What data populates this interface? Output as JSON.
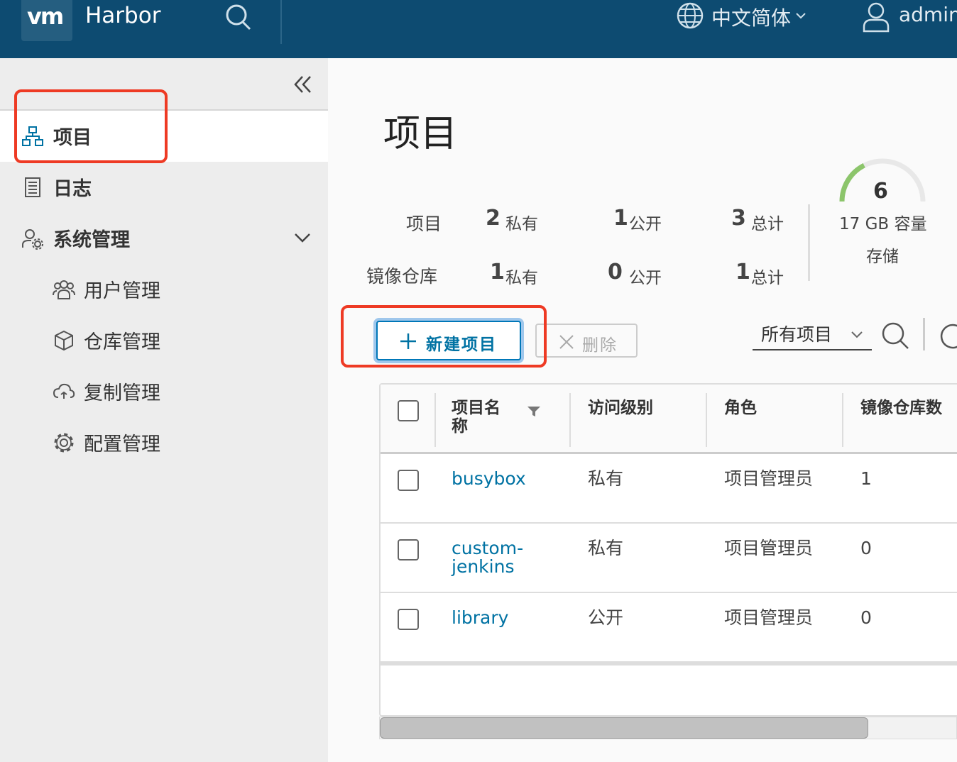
{
  "header": {
    "logo": "vm",
    "app_title": "Harbor",
    "language": "中文简体",
    "user": "admin"
  },
  "sidebar": {
    "items": [
      {
        "label": "项目",
        "icon": "project-icon",
        "active": true
      },
      {
        "label": "日志",
        "icon": "log-icon"
      },
      {
        "label": "系统管理",
        "icon": "admin-icon",
        "expanded": true
      }
    ],
    "sub_items": [
      {
        "label": "用户管理",
        "icon": "users-icon"
      },
      {
        "label": "仓库管理",
        "icon": "box-icon"
      },
      {
        "label": "复制管理",
        "icon": "cloud-sync-icon"
      },
      {
        "label": "配置管理",
        "icon": "gear-icon"
      }
    ]
  },
  "main": {
    "title": "项目",
    "stats": {
      "projects": {
        "label": "项目",
        "private": "2",
        "public": "1",
        "total": "3"
      },
      "repos": {
        "label": "镜像仓库",
        "private": "1",
        "public": "0",
        "total": "1"
      },
      "private_unit": "私有",
      "public_unit": "公开",
      "total_unit": "总计"
    },
    "storage": {
      "value": "6",
      "caption": "17 GB 容量",
      "label": "存储",
      "fill_fraction": 0.35
    },
    "toolbar": {
      "new_label": "新建项目",
      "delete_label": "删除",
      "filter_value": "所有项目"
    },
    "table": {
      "columns": [
        "项目名称",
        "访问级别",
        "角色",
        "镜像仓库数"
      ],
      "rows": [
        {
          "name": "busybox",
          "access": "私有",
          "role": "项目管理员",
          "repos": "1"
        },
        {
          "name": "custom-jenkins",
          "name_l1": "custom-",
          "name_l2": "jenkins",
          "access": "私有",
          "role": "项目管理员",
          "repos": "0"
        },
        {
          "name": "library",
          "access": "公开",
          "role": "项目管理员",
          "repos": "0"
        }
      ]
    }
  },
  "colors": {
    "header_bg": "#0d4b71",
    "sidebar_bg": "#ededed",
    "link": "#0072a3",
    "highlight": "#ee3a24",
    "gauge": "#8cc56b"
  }
}
